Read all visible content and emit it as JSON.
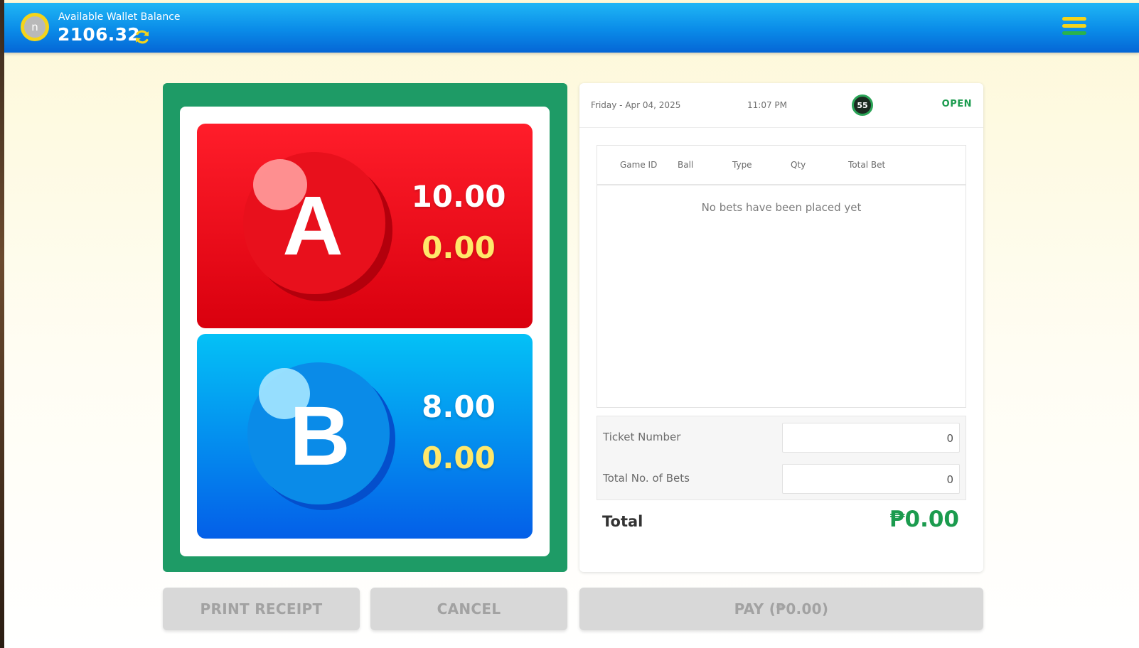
{
  "header": {
    "avatar_initial": "n",
    "wallet_label": "Available Wallet Balance",
    "wallet_amount": "2106.32",
    "refresh_icon": "refresh-icon",
    "menu_icon": "hamburger-menu-icon",
    "colors": {
      "header_top": "#1fb6f5",
      "header_bottom": "#0566d6",
      "coin": "#f4d41a",
      "menu_bars": [
        "#f4d41a",
        "#f4d41a",
        "#2ab34a"
      ]
    }
  },
  "balls": [
    {
      "letter": "A",
      "odds": "10.00",
      "stake": "0.00",
      "color": "#e8101c"
    },
    {
      "letter": "B",
      "odds": "8.00",
      "stake": "0.00",
      "color": "#0a8be8"
    }
  ],
  "ticket": {
    "date": "Friday - Apr 04, 2025",
    "time": "11:07 PM",
    "round": "55",
    "status": "OPEN",
    "columns": [
      "Game ID",
      "Ball",
      "Type",
      "Qty",
      "Total Bet"
    ],
    "empty_message": "No bets have been placed yet",
    "ticket_number_label": "Ticket Number",
    "ticket_number": "0",
    "total_bets_label": "Total No. of Bets",
    "total_bets": "0",
    "total_label": "Total",
    "total_value": "₱0.00"
  },
  "actions": {
    "print": "PRINT RECEIPT",
    "cancel": "CANCEL",
    "pay": "PAY (₱0.00)"
  }
}
